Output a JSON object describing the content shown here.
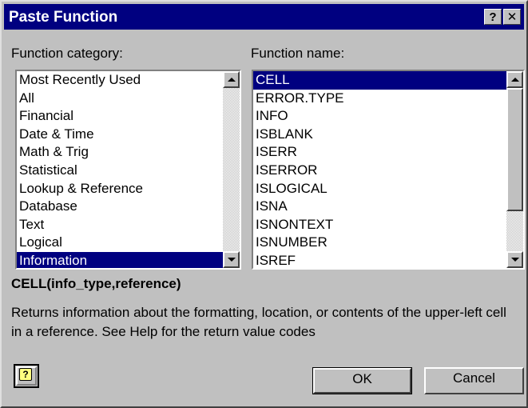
{
  "window": {
    "title": "Paste Function",
    "help_glyph": "?",
    "close_glyph": "✕"
  },
  "category": {
    "label": "Function category:",
    "items": [
      "Most Recently Used",
      "All",
      "Financial",
      "Date & Time",
      "Math & Trig",
      "Statistical",
      "Lookup & Reference",
      "Database",
      "Text",
      "Logical",
      "Information"
    ],
    "selected_index": 10
  },
  "function": {
    "label": "Function name:",
    "items": [
      "CELL",
      "ERROR.TYPE",
      "INFO",
      "ISBLANK",
      "ISERR",
      "ISERROR",
      "ISLOGICAL",
      "ISNA",
      "ISNONTEXT",
      "ISNUMBER",
      "ISREF"
    ],
    "selected_index": 0
  },
  "syntax": "CELL(info_type,reference)",
  "description": "Returns information about the formatting, location, or contents of the upper-left cell in a reference. See Help for the return value codes",
  "buttons": {
    "help_icon": "office-assistant-icon",
    "help_glyph": "?",
    "ok": "OK",
    "cancel": "Cancel"
  }
}
